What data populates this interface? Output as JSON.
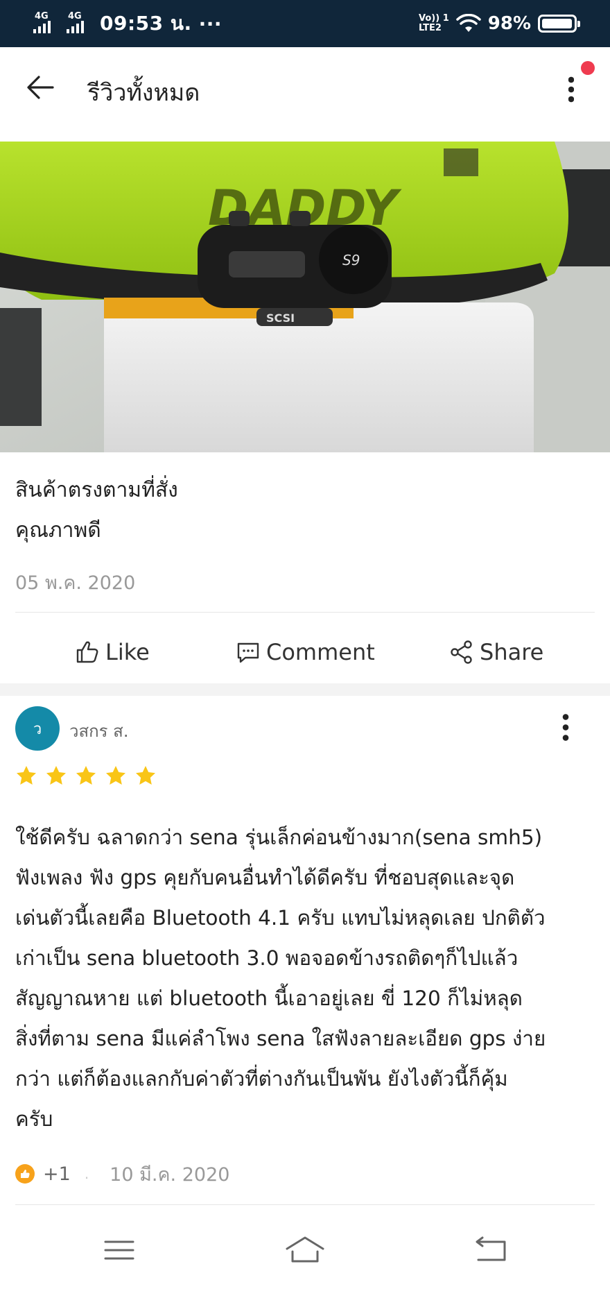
{
  "status_bar": {
    "network_1": "4G",
    "network_2": "4G",
    "time": "09:53 น.",
    "more": "···",
    "volte_line1": "Vo)) 1",
    "volte_line2": "LTE2",
    "battery_percent": "98%",
    "battery_level": 0.98
  },
  "header": {
    "title": "รีวิวทั้งหมด",
    "back_icon": "arrow-left-icon",
    "more_icon": "more-vertical-icon",
    "notification_color": "#ef3b4f"
  },
  "review_1": {
    "photo_icon": "product-photo",
    "lines": [
      "สินค้าตรงตามที่สั่ง",
      "คุณภาพดี"
    ],
    "date": "05 พ.ค. 2020",
    "actions": {
      "like": "Like",
      "comment": "Comment",
      "share": "Share"
    }
  },
  "review_2": {
    "avatar_initial": "ว",
    "avatar_color": "#148aa8",
    "username": "วสกร ส.",
    "rating": 5,
    "text": "ใช้ดีครับ ฉลาดกว่า sena รุ่นเล็กค่อนข้างมาก(sena smh5)\nฟังเพลง ฟัง gps คุยกับคนอื่นทำได้ดีครับ ที่ชอบสุดและจุด\nเด่นตัวนี้เลยคือ Bluetooth 4.1 ครับ แทบไม่หลุดเลย ปกติตัว\nเก่าเป็น sena bluetooth 3.0 พอจอดข้างรถติดๆก็ไปแล้ว\nสัญญาณหาย แต่ bluetooth นี้เอาอยู่เลย ขี่ 120 ก็ไม่หลุด\nสิ่งที่ตาม sena มีแค่ลำโพง sena ใสฟังลายละเอียด gps ง่าย\nกว่า แต่ก็ต้องแลกกับค่าตัวที่ต่างกันเป็นพัน ยังไงตัวนี้ก็คุ้ม\nครับ",
    "like_count": "+1",
    "date": "10 มี.ค. 2020",
    "star_color": "#f9c517",
    "like_badge_color": "#f7a21b"
  },
  "nav_bar": {
    "menu_icon": "menu-icon",
    "home_icon": "home-icon",
    "back_icon": "back-icon"
  }
}
